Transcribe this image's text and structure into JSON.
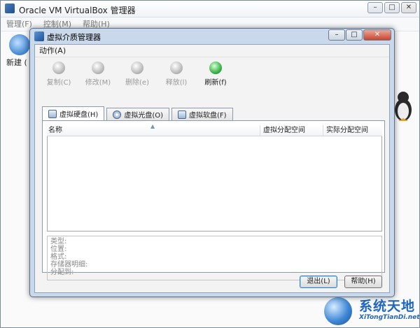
{
  "main_window": {
    "title": "Oracle VM VirtualBox 管理器",
    "menu": [
      "管理(F)",
      "控制(M)",
      "帮助(H)"
    ],
    "new_label": "新建 ("
  },
  "dialog": {
    "title": "虚拟介质管理器",
    "menu_action": "动作(A)",
    "toolbar": [
      {
        "label": "复制(C)",
        "icon": "copy-disk-icon",
        "enabled": false
      },
      {
        "label": "修改(M)",
        "icon": "modify-disk-icon",
        "enabled": false
      },
      {
        "label": "删除(e)",
        "icon": "delete-disk-icon",
        "enabled": false
      },
      {
        "label": "释放(l)",
        "icon": "release-disk-icon",
        "enabled": false
      },
      {
        "label": "刷新(f)",
        "icon": "refresh-icon",
        "enabled": true
      }
    ],
    "tabs": [
      {
        "label": "虚拟硬盘(H)",
        "icon": "hard-disk-icon",
        "selected": true
      },
      {
        "label": "虚拟光盘(O)",
        "icon": "optical-disk-icon",
        "selected": false
      },
      {
        "label": "虚拟软盘(F)",
        "icon": "floppy-disk-icon",
        "selected": false
      }
    ],
    "columns": {
      "name": "名称",
      "virtual_size": "虚拟分配空间",
      "actual_size": "实际分配空间"
    },
    "details": [
      "类型:",
      "位置:",
      "格式:",
      "存储器明细:",
      "分配到:"
    ],
    "buttons": {
      "exit": "退出(L)",
      "help": "帮助(H)"
    }
  },
  "watermark": {
    "title": "系统天地",
    "subtitle": "XiTongTianDi.net"
  }
}
